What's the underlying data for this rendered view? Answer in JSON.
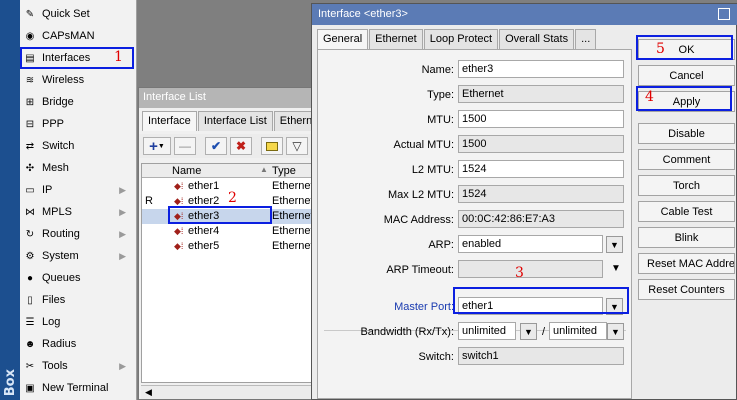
{
  "brand": "Box",
  "menu": [
    {
      "id": "quick-set",
      "label": "Quick Set",
      "icon": "quick-set-icon",
      "glyph": "✎",
      "arrow": false
    },
    {
      "id": "capsman",
      "label": "CAPsMAN",
      "icon": "capsman-icon",
      "glyph": "◉",
      "arrow": false
    },
    {
      "id": "interfaces",
      "label": "Interfaces",
      "icon": "interfaces-icon",
      "glyph": "▤",
      "arrow": false
    },
    {
      "id": "wireless",
      "label": "Wireless",
      "icon": "wireless-icon",
      "glyph": "≋",
      "arrow": false
    },
    {
      "id": "bridge",
      "label": "Bridge",
      "icon": "bridge-icon",
      "glyph": "⊞",
      "arrow": false
    },
    {
      "id": "ppp",
      "label": "PPP",
      "icon": "ppp-icon",
      "glyph": "⊟",
      "arrow": false
    },
    {
      "id": "switch",
      "label": "Switch",
      "icon": "switch-icon",
      "glyph": "⇄",
      "arrow": false
    },
    {
      "id": "mesh",
      "label": "Mesh",
      "icon": "mesh-icon",
      "glyph": "✣",
      "arrow": false
    },
    {
      "id": "ip",
      "label": "IP",
      "icon": "ip-icon",
      "glyph": "▭",
      "arrow": true
    },
    {
      "id": "mpls",
      "label": "MPLS",
      "icon": "mpls-icon",
      "glyph": "⋈",
      "arrow": true
    },
    {
      "id": "routing",
      "label": "Routing",
      "icon": "routing-icon",
      "glyph": "↻",
      "arrow": true
    },
    {
      "id": "system",
      "label": "System",
      "icon": "system-icon",
      "glyph": "⚙",
      "arrow": true
    },
    {
      "id": "queues",
      "label": "Queues",
      "icon": "queues-icon",
      "glyph": "●",
      "arrow": false
    },
    {
      "id": "files",
      "label": "Files",
      "icon": "files-icon",
      "glyph": "▯",
      "arrow": false
    },
    {
      "id": "log",
      "label": "Log",
      "icon": "log-icon",
      "glyph": "☰",
      "arrow": false
    },
    {
      "id": "radius",
      "label": "Radius",
      "icon": "radius-icon",
      "glyph": "☻",
      "arrow": false
    },
    {
      "id": "tools",
      "label": "Tools",
      "icon": "tools-icon",
      "glyph": "✂",
      "arrow": true
    },
    {
      "id": "new-terminal",
      "label": "New Terminal",
      "icon": "terminal-icon",
      "glyph": "▣",
      "arrow": false
    }
  ],
  "annotations": {
    "n1": "1",
    "n2": "2",
    "n3": "3",
    "n4": "4",
    "n5": "5"
  },
  "iflist": {
    "title": "Interface List",
    "tabs": [
      "Interface",
      "Interface List",
      "Etherne"
    ],
    "columns": {
      "flag": "",
      "name": "Name",
      "type": "Type"
    },
    "rows": [
      {
        "flag": "",
        "name": "ether1",
        "type": "Ethernet"
      },
      {
        "flag": "R",
        "name": "ether2",
        "type": "Ethernet"
      },
      {
        "flag": "",
        "name": "ether3",
        "type": "Ethernet"
      },
      {
        "flag": "",
        "name": "ether4",
        "type": "Ethernet"
      },
      {
        "flag": "",
        "name": "ether5",
        "type": "Ethernet"
      }
    ],
    "selected_index": 2
  },
  "dialog": {
    "title": "Interface <ether3>",
    "tabs": [
      "General",
      "Ethernet",
      "Loop Protect",
      "Overall Stats",
      "..."
    ],
    "fields": {
      "name": {
        "label": "Name:",
        "value": "ether3"
      },
      "type": {
        "label": "Type:",
        "value": "Ethernet"
      },
      "mtu": {
        "label": "MTU:",
        "value": "1500"
      },
      "actual_mtu": {
        "label": "Actual MTU:",
        "value": "1500"
      },
      "l2_mtu": {
        "label": "L2 MTU:",
        "value": "1524"
      },
      "max_l2_mtu": {
        "label": "Max L2 MTU:",
        "value": "1524"
      },
      "mac": {
        "label": "MAC Address:",
        "value": "00:0C:42:86:E7:A3"
      },
      "arp": {
        "label": "ARP:",
        "value": "enabled"
      },
      "arp_timeout": {
        "label": "ARP Timeout:",
        "value": ""
      },
      "master_port": {
        "label": "Master Port:",
        "value": "ether1"
      },
      "bandwidth": {
        "label": "Bandwidth (Rx/Tx):",
        "rx": "unlimited",
        "tx": "unlimited",
        "sep": "/"
      },
      "switch": {
        "label": "Switch:",
        "value": "switch1"
      }
    },
    "buttons": {
      "ok": "OK",
      "cancel": "Cancel",
      "apply": "Apply",
      "disable": "Disable",
      "comment": "Comment",
      "torch": "Torch",
      "cable_test": "Cable Test",
      "blink": "Blink",
      "reset_mac": "Reset MAC Address",
      "reset_counters": "Reset Counters"
    }
  },
  "colors": {
    "annotation_box": "#0b1fe0",
    "annotation_number": "#e00000",
    "title_bar": "#5b7bb5",
    "brand_strip": "#1c4f8f"
  }
}
